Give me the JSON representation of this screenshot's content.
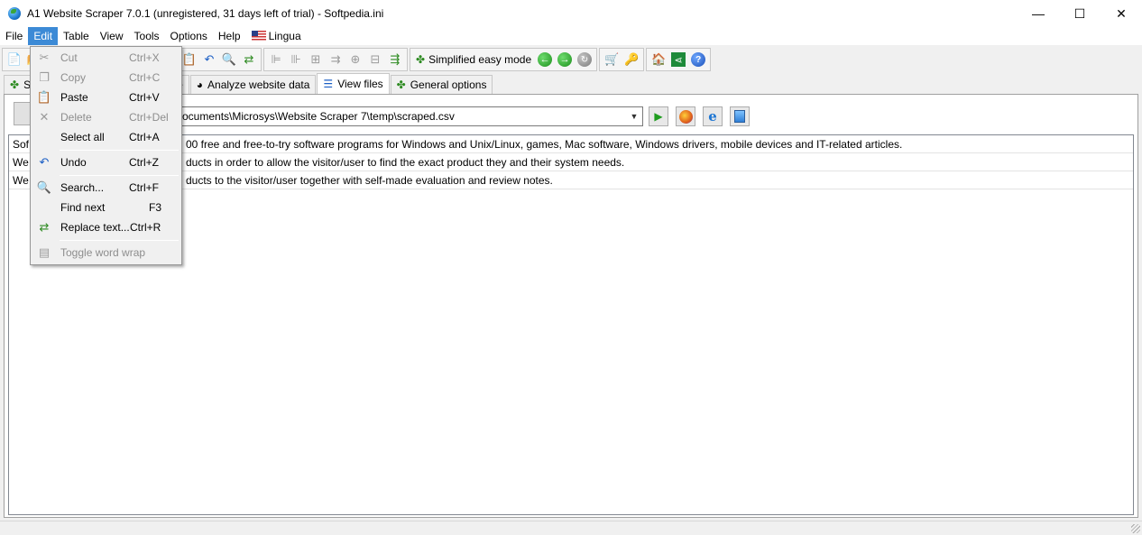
{
  "window": {
    "title": "A1 Website Scraper 7.0.1 (unregistered, 31 days left of trial) - Softpedia.ini",
    "minimize": "—",
    "maximize": "☐",
    "close": "✕"
  },
  "menubar": {
    "items": [
      "File",
      "Edit",
      "Table",
      "View",
      "Tools",
      "Options",
      "Help",
      "Lingua"
    ],
    "active": "Edit"
  },
  "toolbar": {
    "simplified_mode_label": "Simplified easy mode"
  },
  "tabs": {
    "items": [
      {
        "label": "S"
      },
      {
        "label": "site"
      },
      {
        "label": "Analyze website data"
      },
      {
        "label": "View files"
      },
      {
        "label": "General options"
      }
    ],
    "selected": "View files"
  },
  "file_path": {
    "value": "ocuments\\Microsys\\Website Scraper 7\\temp\\scraped.csv"
  },
  "grid": {
    "rows": [
      {
        "col_a": "Soft",
        "col_b": "00 free and free-to-try software programs for Windows and Unix/Linux, games, Mac software, Windows drivers, mobile devices and IT-related articles."
      },
      {
        "col_a": "We",
        "col_b": "ducts in order to allow the visitor/user to find the exact product they and their system needs."
      },
      {
        "col_a": "We",
        "col_b": "ducts to the visitor/user together with self-made evaluation and review notes."
      }
    ]
  },
  "edit_menu": {
    "cut": {
      "label": "Cut",
      "shortcut": "Ctrl+X"
    },
    "copy": {
      "label": "Copy",
      "shortcut": "Ctrl+C"
    },
    "paste": {
      "label": "Paste",
      "shortcut": "Ctrl+V"
    },
    "delete": {
      "label": "Delete",
      "shortcut": "Ctrl+Del"
    },
    "select_all": {
      "label": "Select all",
      "shortcut": "Ctrl+A"
    },
    "undo": {
      "label": "Undo",
      "shortcut": "Ctrl+Z"
    },
    "search": {
      "label": "Search...",
      "shortcut": "Ctrl+F"
    },
    "find_next": {
      "label": "Find next",
      "shortcut": "F3"
    },
    "replace_text": {
      "label": "Replace text...",
      "shortcut": "Ctrl+R"
    },
    "toggle_word_wrap": {
      "label": "Toggle word wrap"
    }
  },
  "icons": {
    "app": "globe-icon",
    "new": "new-file-icon",
    "undo": "undo-icon",
    "search": "magnifier-icon",
    "go_back": "green-back-arrow-icon",
    "go_forward": "green-forward-arrow-icon",
    "refresh": "refresh-icon",
    "cart": "cart-icon",
    "key": "key-icon",
    "home": "home-icon",
    "share": "share-icon",
    "help": "help-icon"
  },
  "colors": {
    "menu_highlight": "#3c8ad6",
    "window_bg": "#f0f0f0"
  }
}
